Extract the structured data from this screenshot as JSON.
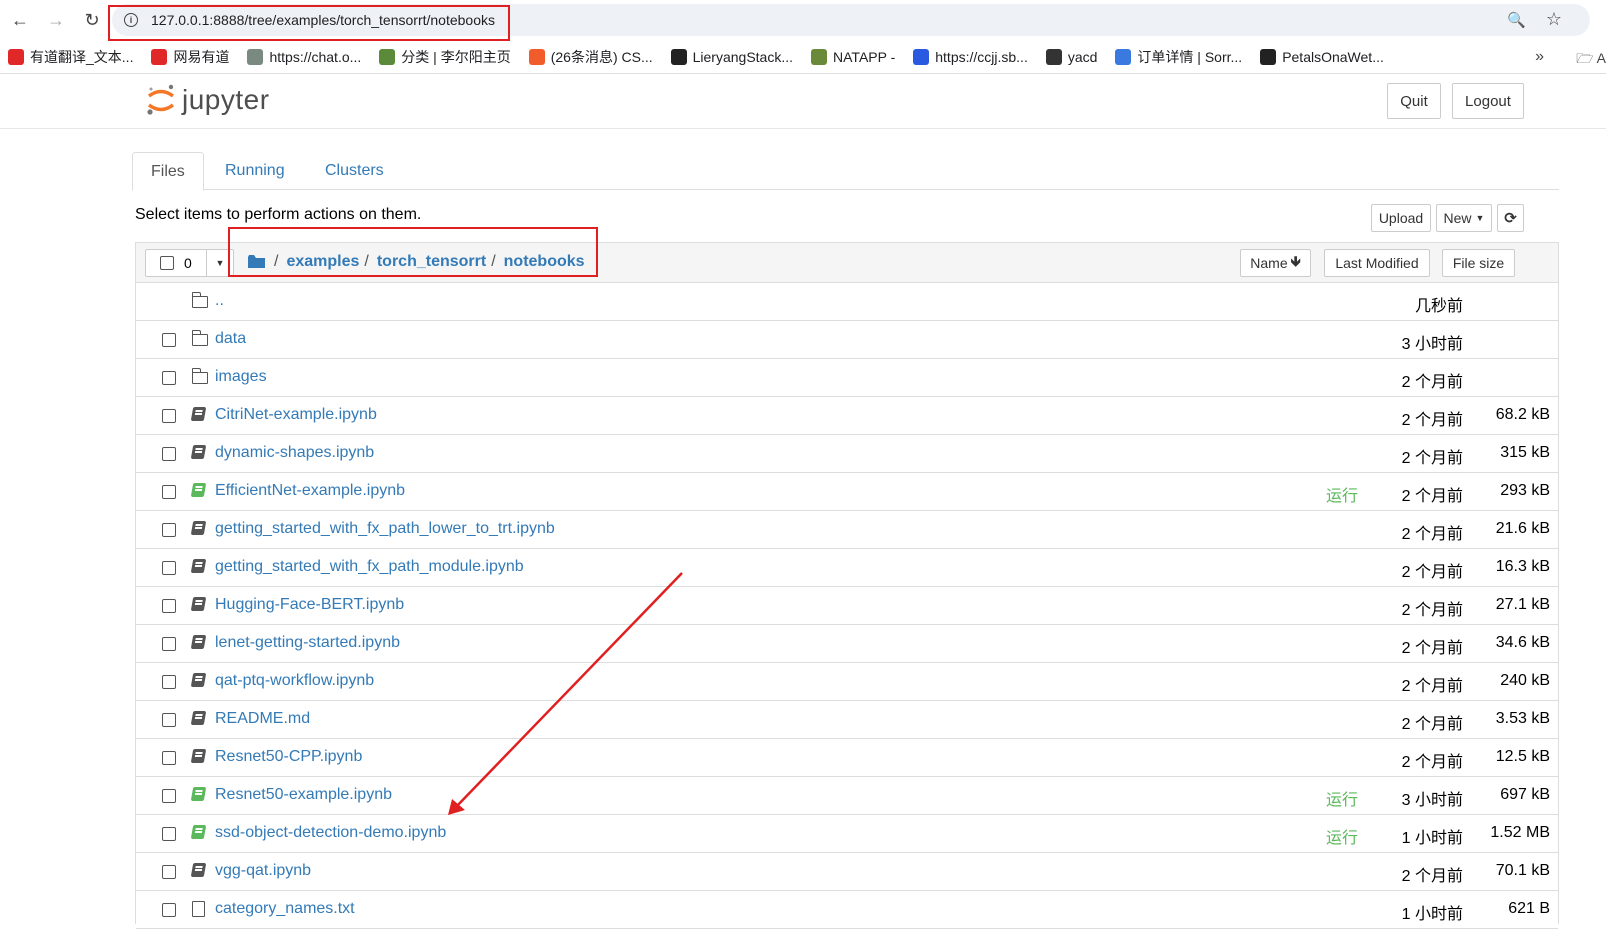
{
  "browser": {
    "url": "127.0.0.1:8888/tree/examples/torch_tensorrt/notebooks",
    "bookmarks": [
      {
        "label": "有道翻译_文本...",
        "icon": "youdao-fanyi-icon",
        "color": "#e02828"
      },
      {
        "label": "网易有道",
        "icon": "youdao-icon",
        "color": "#e02828"
      },
      {
        "label": "https://chat.o...",
        "icon": "openai-icon",
        "color": "#7a8a80"
      },
      {
        "label": "分类 | 李尔阳主页",
        "icon": "landscape-icon",
        "color": "#5a8a3a"
      },
      {
        "label": "(26条消息) CS...",
        "icon": "csdn-icon",
        "color": "#f25c2a"
      },
      {
        "label": "LieryangStack...",
        "icon": "github-icon",
        "color": "#222"
      },
      {
        "label": "NATAPP -",
        "icon": "natapp-icon",
        "color": "#6a8a3a"
      },
      {
        "label": "https://ccjj.sb...",
        "icon": "arrow-logo-icon",
        "color": "#2a5ae0"
      },
      {
        "label": "yacd",
        "icon": "cat-icon",
        "color": "#333"
      },
      {
        "label": "订单详情 | Sorr...",
        "icon": "order-icon",
        "color": "#3a7ae0"
      },
      {
        "label": "PetalsOnaWet...",
        "icon": "github-icon",
        "color": "#222"
      }
    ],
    "more": "»",
    "folder_label": "A"
  },
  "jupyter": {
    "logo": "jupyter",
    "quit": "Quit",
    "logout": "Logout",
    "tabs": [
      "Files",
      "Running",
      "Clusters"
    ],
    "hint": "Select items to perform actions on them.",
    "upload": "Upload",
    "new": "New",
    "selected_count": "0",
    "breadcrumb": [
      "examples",
      "torch_tensorrt",
      "notebooks"
    ],
    "columns": {
      "name": "Name",
      "modified": "Last Modified",
      "size": "File size"
    },
    "files": [
      {
        "name": "..",
        "type": "folder",
        "modified": "几秒前",
        "size": "",
        "running": "",
        "checkbox": false
      },
      {
        "name": "data",
        "type": "folder",
        "modified": "3 小时前",
        "size": "",
        "running": "",
        "checkbox": true
      },
      {
        "name": "images",
        "type": "folder",
        "modified": "2 个月前",
        "size": "",
        "running": "",
        "checkbox": true
      },
      {
        "name": "CitriNet-example.ipynb",
        "type": "notebook",
        "modified": "2 个月前",
        "size": "68.2 kB",
        "running": "",
        "checkbox": true
      },
      {
        "name": "dynamic-shapes.ipynb",
        "type": "notebook",
        "modified": "2 个月前",
        "size": "315 kB",
        "running": "",
        "checkbox": true
      },
      {
        "name": "EfficientNet-example.ipynb",
        "type": "notebook-running",
        "modified": "2 个月前",
        "size": "293 kB",
        "running": "运行",
        "checkbox": true
      },
      {
        "name": "getting_started_with_fx_path_lower_to_trt.ipynb",
        "type": "notebook",
        "modified": "2 个月前",
        "size": "21.6 kB",
        "running": "",
        "checkbox": true
      },
      {
        "name": "getting_started_with_fx_path_module.ipynb",
        "type": "notebook",
        "modified": "2 个月前",
        "size": "16.3 kB",
        "running": "",
        "checkbox": true
      },
      {
        "name": "Hugging-Face-BERT.ipynb",
        "type": "notebook",
        "modified": "2 个月前",
        "size": "27.1 kB",
        "running": "",
        "checkbox": true
      },
      {
        "name": "lenet-getting-started.ipynb",
        "type": "notebook",
        "modified": "2 个月前",
        "size": "34.6 kB",
        "running": "",
        "checkbox": true
      },
      {
        "name": "qat-ptq-workflow.ipynb",
        "type": "notebook",
        "modified": "2 个月前",
        "size": "240 kB",
        "running": "",
        "checkbox": true
      },
      {
        "name": "README.md",
        "type": "notebook",
        "modified": "2 个月前",
        "size": "3.53 kB",
        "running": "",
        "checkbox": true
      },
      {
        "name": "Resnet50-CPP.ipynb",
        "type": "notebook",
        "modified": "2 个月前",
        "size": "12.5 kB",
        "running": "",
        "checkbox": true
      },
      {
        "name": "Resnet50-example.ipynb",
        "type": "notebook-running",
        "modified": "3 小时前",
        "size": "697 kB",
        "running": "运行",
        "checkbox": true
      },
      {
        "name": "ssd-object-detection-demo.ipynb",
        "type": "notebook-running",
        "modified": "1 小时前",
        "size": "1.52 MB",
        "running": "运行",
        "checkbox": true
      },
      {
        "name": "vgg-qat.ipynb",
        "type": "notebook",
        "modified": "2 个月前",
        "size": "70.1 kB",
        "running": "",
        "checkbox": true
      },
      {
        "name": "category_names.txt",
        "type": "file",
        "modified": "1 小时前",
        "size": "621 B",
        "running": "",
        "checkbox": true
      }
    ]
  },
  "annotation_color": "#e02020"
}
